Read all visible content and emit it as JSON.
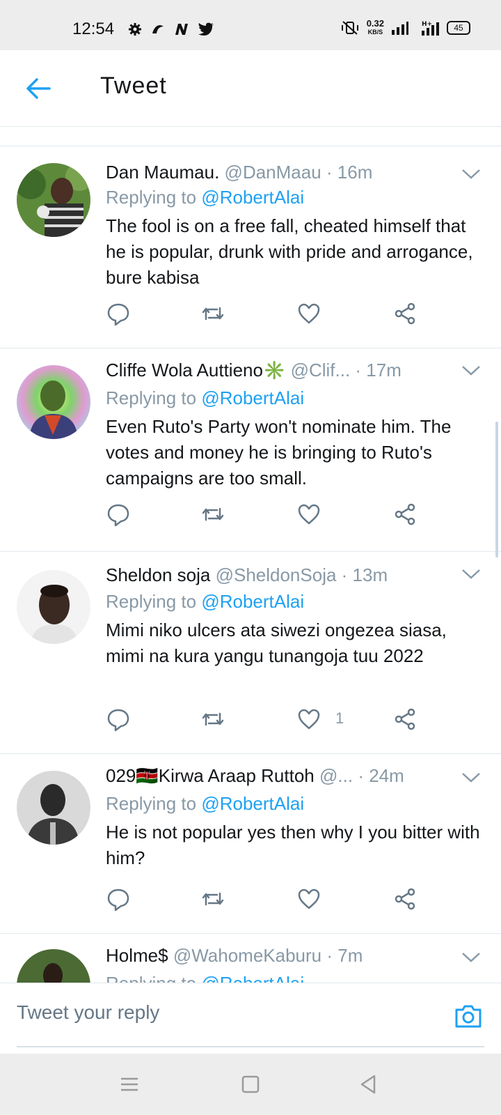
{
  "status_bar": {
    "time": "12:54",
    "speed_value": "0.32",
    "speed_unit": "KB/S",
    "network": "H+",
    "battery": "45"
  },
  "app_bar": {
    "title": "Tweet"
  },
  "tweets": [
    {
      "name": "Dan Maumau.",
      "handle": "@DanMaau",
      "time": "· 16m",
      "replying_prefix": "Replying to",
      "replying_to": "@RobertAlai",
      "text": "The fool is on a free fall, cheated himself that he is popular, drunk with pride and arrogance, bure kabisa",
      "like_count": ""
    },
    {
      "name": "Cliffe Wola Auttieno✳️",
      "handle": "@Clif...",
      "time": "· 17m",
      "replying_prefix": "Replying to",
      "replying_to": "@RobertAlai",
      "text": "Even Ruto's Party won't nominate him. The votes and money he is bringing to Ruto's campaigns are too small.",
      "like_count": ""
    },
    {
      "name": "Sheldon soja",
      "handle": "@SheldonSoja",
      "time": "· 13m",
      "replying_prefix": "Replying to",
      "replying_to": "@RobertAlai",
      "text": "Mimi niko ulcers ata siwezi ongezea siasa, mimi na kura yangu tunangoja tuu 2022",
      "like_count": "1"
    },
    {
      "name": "029🇰🇪Kirwa Araap Ruttoh",
      "handle": "@...",
      "time": "· 24m",
      "replying_prefix": "Replying to",
      "replying_to": "@RobertAlai",
      "text": "He is not popular yes then why I you bitter with him?",
      "like_count": ""
    },
    {
      "name": "Holme$",
      "handle": "@WahomeKaburu",
      "time": "· 7m",
      "replying_prefix": "Replying to",
      "replying_to": "@RobertAlai",
      "text": "",
      "like_count": ""
    }
  ],
  "reply_bar": {
    "placeholder": "Tweet your reply"
  },
  "icons": {
    "back": "arrow-left-icon",
    "reply": "comment-icon",
    "retweet": "retweet-icon",
    "like": "heart-icon",
    "share": "share-icon",
    "camera": "camera-icon",
    "caret": "chevron-down-icon"
  },
  "colors": {
    "accent": "#1da1f2",
    "muted": "#8899a6",
    "text": "#14171a",
    "divider": "#e1e8ed"
  }
}
